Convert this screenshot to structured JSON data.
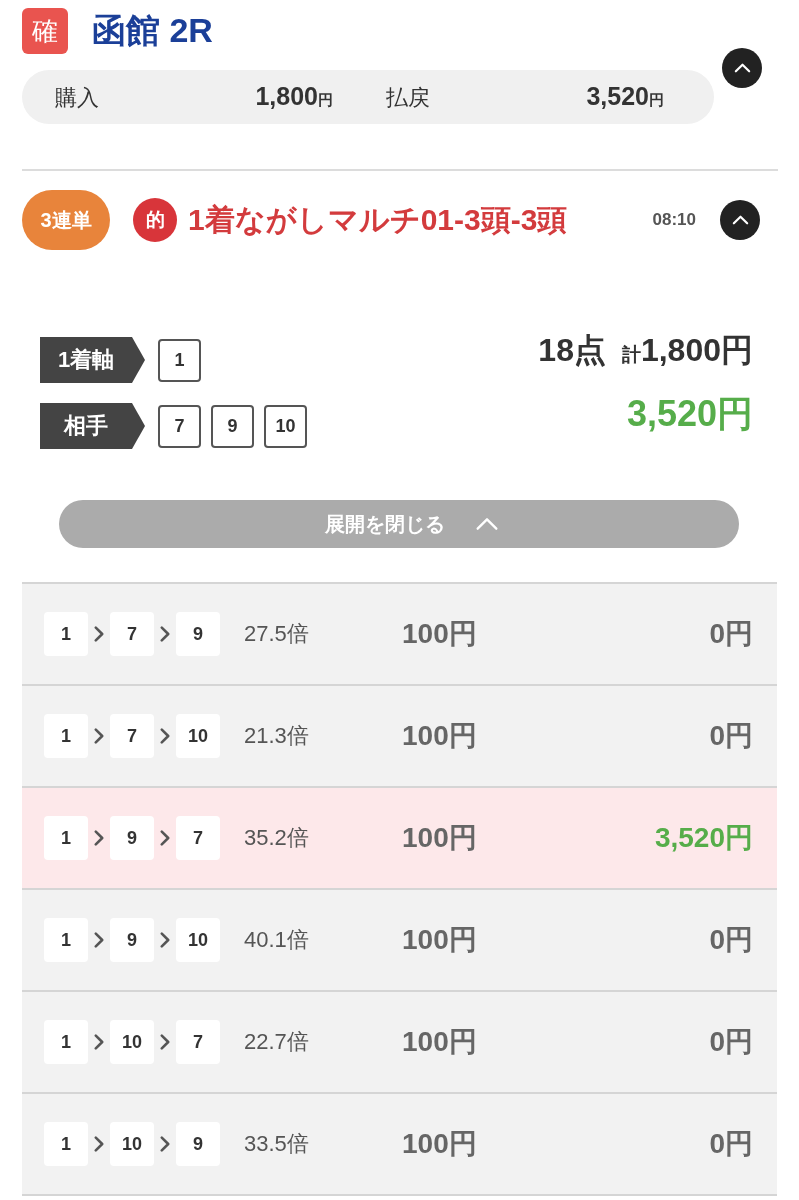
{
  "race": {
    "status_badge": "確",
    "title": "函館 2R",
    "expanded": true,
    "summary": [
      {
        "label": "購入",
        "amount": "1,800",
        "unit": "円"
      },
      {
        "label": "払戻",
        "amount": "3,520",
        "unit": "円"
      }
    ]
  },
  "bet": {
    "type": "3連単",
    "hit_mark": "的",
    "title": "1着ながしマルチ01-3頭-3頭",
    "time": "08:10",
    "expanded": true
  },
  "selection": {
    "groups": [
      {
        "label": "1着軸",
        "numbers": [
          "1"
        ]
      },
      {
        "label": "相手",
        "numbers": [
          "7",
          "9",
          "10"
        ]
      }
    ],
    "points": "18点",
    "total_label": "計",
    "total": "1,800円",
    "payout": "3,520円"
  },
  "toggle_button": {
    "label": "展開を閉じる"
  },
  "combinations": [
    {
      "numbers": [
        "1",
        "7",
        "9"
      ],
      "odds": "27.5倍",
      "stake": "100円",
      "payout": "0円",
      "hit": false
    },
    {
      "numbers": [
        "1",
        "7",
        "10"
      ],
      "odds": "21.3倍",
      "stake": "100円",
      "payout": "0円",
      "hit": false
    },
    {
      "numbers": [
        "1",
        "9",
        "7"
      ],
      "odds": "35.2倍",
      "stake": "100円",
      "payout": "3,520円",
      "hit": true
    },
    {
      "numbers": [
        "1",
        "9",
        "10"
      ],
      "odds": "40.1倍",
      "stake": "100円",
      "payout": "0円",
      "hit": false
    },
    {
      "numbers": [
        "1",
        "10",
        "7"
      ],
      "odds": "22.7倍",
      "stake": "100円",
      "payout": "0円",
      "hit": false
    },
    {
      "numbers": [
        "1",
        "10",
        "9"
      ],
      "odds": "33.5倍",
      "stake": "100円",
      "payout": "0円",
      "hit": false
    }
  ]
}
